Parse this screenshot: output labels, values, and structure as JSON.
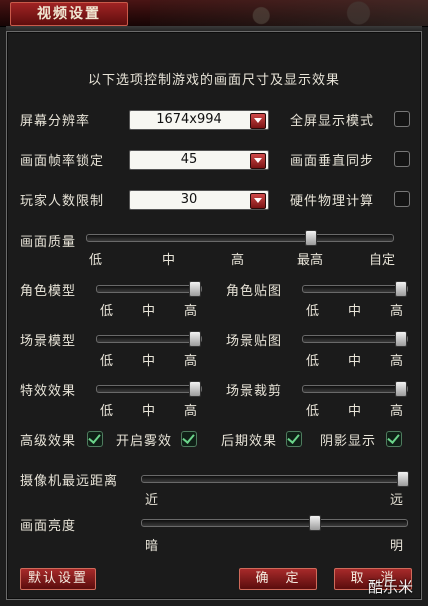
{
  "window": {
    "title": "视频设置"
  },
  "header": "以下选项控制游戏的画面尺寸及显示效果",
  "resolution": {
    "label": "屏幕分辨率",
    "value": "1674x994"
  },
  "framerate": {
    "label": "画面帧率锁定",
    "value": "45"
  },
  "players": {
    "label": "玩家人数限制",
    "value": "30"
  },
  "toggles_right": [
    {
      "label": "全屏显示模式",
      "checked": false
    },
    {
      "label": "画面垂直同步",
      "checked": false
    },
    {
      "label": "硬件物理计算",
      "checked": false
    }
  ],
  "quality": {
    "label": "画面质量",
    "level": "最高",
    "ticks": [
      "低",
      "中",
      "高",
      "最高",
      "自定"
    ]
  },
  "sliders": [
    {
      "label": "角色模型",
      "level": "高",
      "ticks": [
        "低",
        "中",
        "高"
      ]
    },
    {
      "label": "角色贴图",
      "level": "高",
      "ticks": [
        "低",
        "中",
        "高"
      ]
    },
    {
      "label": "场景模型",
      "level": "高",
      "ticks": [
        "低",
        "中",
        "高"
      ]
    },
    {
      "label": "场景贴图",
      "level": "高",
      "ticks": [
        "低",
        "中",
        "高"
      ]
    },
    {
      "label": "特效效果",
      "level": "高",
      "ticks": [
        "低",
        "中",
        "高"
      ]
    },
    {
      "label": "场景裁剪",
      "level": "高",
      "ticks": [
        "低",
        "中",
        "高"
      ]
    }
  ],
  "effects": [
    {
      "label": "高级效果",
      "checked": true
    },
    {
      "label": "开启雾效",
      "checked": true
    },
    {
      "label": "后期效果",
      "checked": true
    },
    {
      "label": "阴影显示",
      "checked": true
    }
  ],
  "camera": {
    "label": "摄像机最远距离",
    "min": "近",
    "max": "远",
    "value": 1.0
  },
  "brightness": {
    "label": "画面亮度",
    "min": "暗",
    "max": "明",
    "value": 0.65
  },
  "buttons": {
    "default": "默认设置",
    "ok": "确　定",
    "cancel": "取　消"
  },
  "watermark": "酷乐米"
}
